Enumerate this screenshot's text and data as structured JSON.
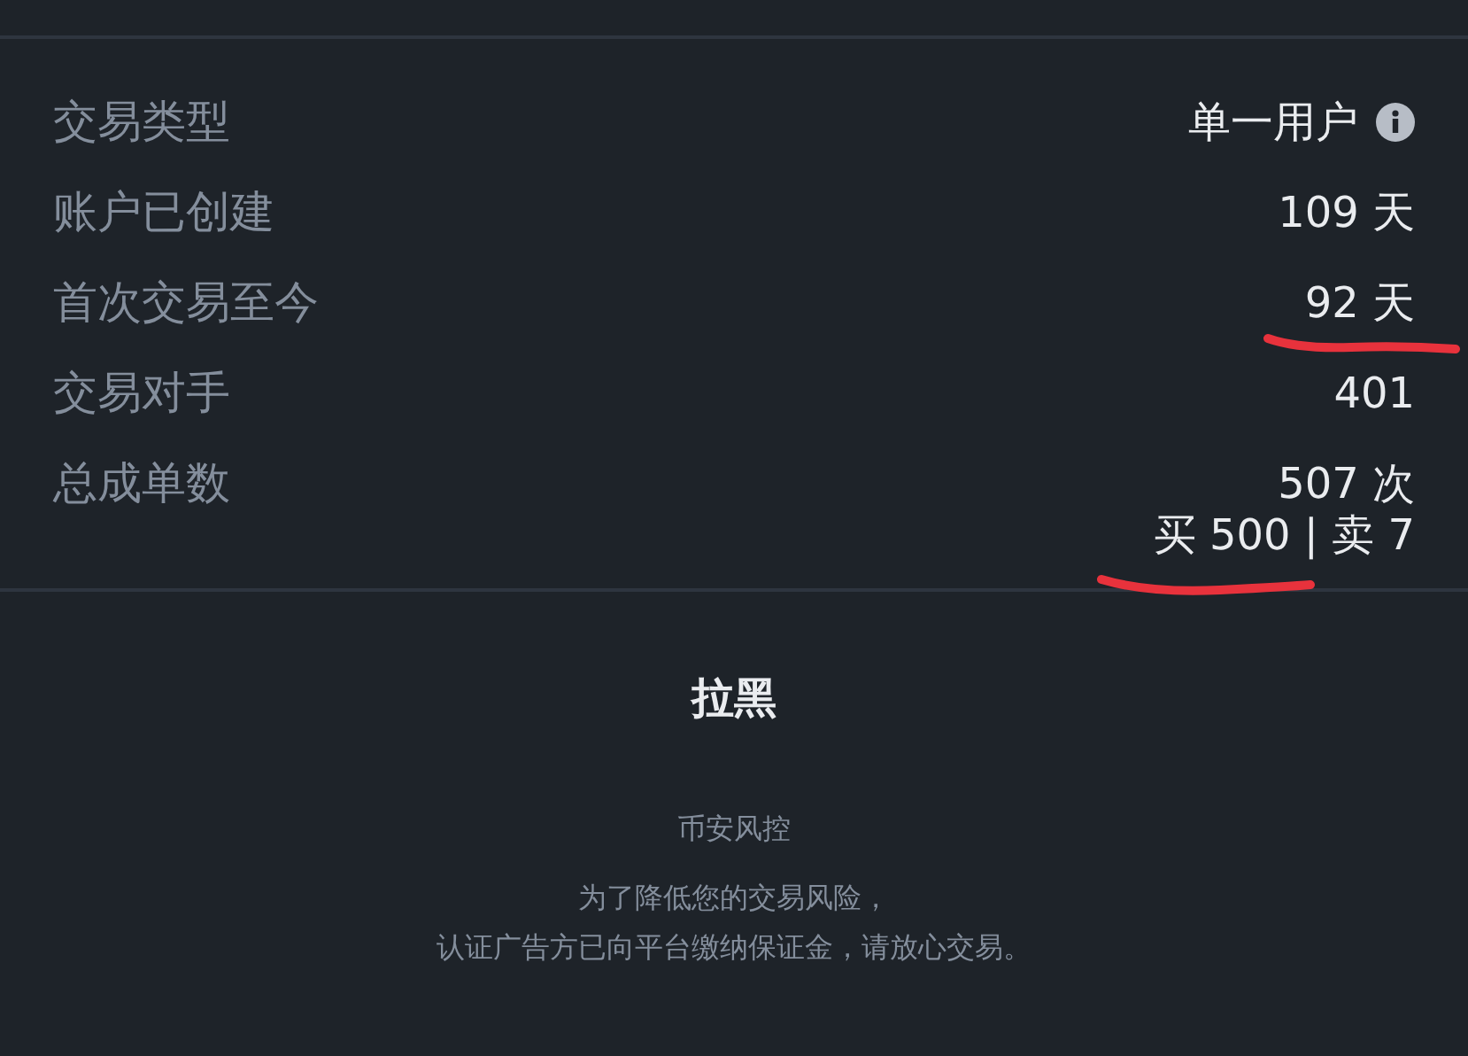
{
  "rows": [
    {
      "label": "交易类型",
      "value": "单一用户",
      "info": true,
      "underlined": false
    },
    {
      "label": "账户已创建",
      "value": "109 天",
      "info": false,
      "underlined": false
    },
    {
      "label": "首次交易至今",
      "value": "92 天",
      "info": false,
      "underlined": true
    },
    {
      "label": "交易对手",
      "value": "401",
      "info": false,
      "underlined": false
    },
    {
      "label": "总成单数",
      "value": "507 次",
      "info": false,
      "underlined": false
    }
  ],
  "order_split": {
    "text": "买 500 | 卖 7",
    "underlined": true
  },
  "block_button": "拉黑",
  "footer": {
    "title": "币安风控",
    "lines": [
      "为了降低您的交易风险，",
      "认证广告方已向平台缴纳保证金，请放心交易。"
    ]
  }
}
